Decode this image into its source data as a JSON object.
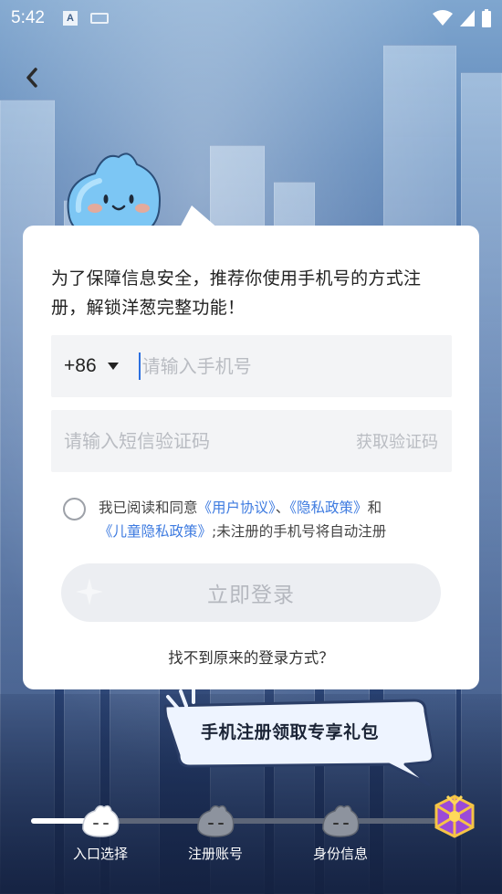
{
  "status_bar": {
    "time": "5:42",
    "input_badge": "A",
    "icons": [
      "keyboard-icon",
      "wifi-icon",
      "signal-icon",
      "battery-icon"
    ]
  },
  "nav": {
    "back_icon": "chevron-left-icon"
  },
  "card": {
    "intro": "为了保障信息安全，推荐你使用手机号的方式注册，解锁洋葱完整功能！",
    "country_code": "+86",
    "phone_placeholder": "请输入手机号",
    "code_placeholder": "请输入短信验证码",
    "get_code": "获取验证码",
    "agreement": {
      "prefix": "我已阅读和同意",
      "user_agreement": "《用户协议》",
      "sep": "、",
      "privacy_policy": "《隐私政策》",
      "and": "和",
      "child_privacy": "《儿童隐私政策》",
      "suffix": ";未注册的手机号将自动注册"
    },
    "login_button": "立即登录",
    "forgot_link": "找不到原来的登录方式？"
  },
  "promo": {
    "label": "手机注册领取专享礼包"
  },
  "progress": {
    "steps": [
      {
        "label": "入口选择",
        "active": true
      },
      {
        "label": "注册账号",
        "active": false
      },
      {
        "label": "身份信息",
        "active": false
      }
    ],
    "reward_icon": "gift-icon"
  },
  "colors": {
    "accent_link": "#3e7be0",
    "cursor": "#2b6fe0",
    "disabled_button": "#eceef2"
  }
}
